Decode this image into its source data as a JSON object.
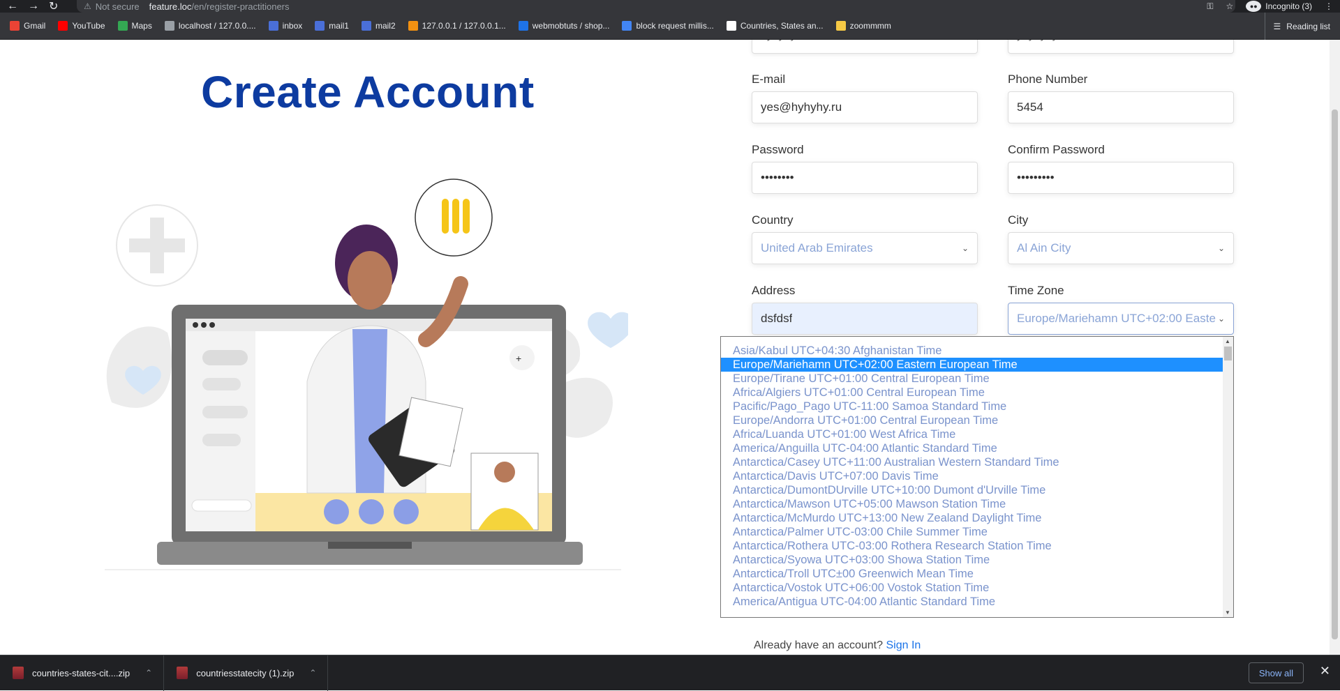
{
  "browser": {
    "not_secure": "Not secure",
    "url_host": "feature.loc",
    "url_path": "/en/register-practitioners",
    "incognito": "Incognito (3)",
    "bookmarks": [
      {
        "label": "Gmail",
        "icon": "gmail-icon",
        "color": "#ea4335"
      },
      {
        "label": "YouTube",
        "icon": "youtube-icon",
        "color": "#ff0000"
      },
      {
        "label": "Maps",
        "icon": "maps-icon",
        "color": "#34a853"
      },
      {
        "label": "localhost / 127.0.0....",
        "icon": "globe-icon",
        "color": "#9aa0a6"
      },
      {
        "label": "inbox",
        "icon": "mail-icon",
        "color": "#4a6fd8"
      },
      {
        "label": "mail1",
        "icon": "mail-icon",
        "color": "#4a6fd8"
      },
      {
        "label": "mail2",
        "icon": "mail-icon",
        "color": "#4a6fd8"
      },
      {
        "label": "127.0.0.1 / 127.0.0.1...",
        "icon": "pma-icon",
        "color": "#f29111"
      },
      {
        "label": "webmobtuts / shop...",
        "icon": "laravel-icon",
        "color": "#1e73e8"
      },
      {
        "label": "block request millis...",
        "icon": "google-icon",
        "color": "#4285f4"
      },
      {
        "label": "Countries, States an...",
        "icon": "github-icon",
        "color": "#ffffff"
      },
      {
        "label": "zoommmm",
        "icon": "folder-icon",
        "color": "#f6c945"
      }
    ],
    "reading_list": "Reading list"
  },
  "page": {
    "title": "Create Account",
    "partial_top_left": "hyhyhyh",
    "partial_top_right": "yhyhyhyh",
    "fields": {
      "email_label": "E-mail",
      "email_value": "yes@hyhyhy.ru",
      "phone_label": "Phone Number",
      "phone_value": "5454",
      "password_label": "Password",
      "password_value": "••••••••",
      "confirm_label": "Confirm Password",
      "confirm_value": "•••••••••",
      "country_label": "Country",
      "country_value": "United Arab Emirates",
      "city_label": "City",
      "city_value": "Al Ain City",
      "address_label": "Address",
      "address_value": "dsfdsf",
      "timezone_label": "Time Zone",
      "timezone_value": "Europe/Mariehamn UTC+02:00 Eastern European Time"
    },
    "timezone_options": [
      "Asia/Kabul UTC+04:30 Afghanistan Time",
      "Europe/Mariehamn UTC+02:00 Eastern European Time",
      "Europe/Tirane UTC+01:00 Central European Time",
      "Africa/Algiers UTC+01:00 Central European Time",
      "Pacific/Pago_Pago UTC-11:00 Samoa Standard Time",
      "Europe/Andorra UTC+01:00 Central European Time",
      "Africa/Luanda UTC+01:00 West Africa Time",
      "America/Anguilla UTC-04:00 Atlantic Standard Time",
      "Antarctica/Casey UTC+11:00 Australian Western Standard Time",
      "Antarctica/Davis UTC+07:00 Davis Time",
      "Antarctica/DumontDUrville UTC+10:00 Dumont d'Urville Time",
      "Antarctica/Mawson UTC+05:00 Mawson Station Time",
      "Antarctica/McMurdo UTC+13:00 New Zealand Daylight Time",
      "Antarctica/Palmer UTC-03:00 Chile Summer Time",
      "Antarctica/Rothera UTC-03:00 Rothera Research Station Time",
      "Antarctica/Syowa UTC+03:00 Showa Station Time",
      "Antarctica/Troll UTC±00 Greenwich Mean Time",
      "Antarctica/Vostok UTC+06:00 Vostok Station Time",
      "America/Antigua UTC-04:00 Atlantic Standard Time"
    ],
    "selected_option_index": 1,
    "already_text": "Already have an account?",
    "sign_in": "Sign In"
  },
  "downloads": {
    "items": [
      "countries-states-cit....zip",
      "countriesstatecity (1).zip"
    ],
    "show_all": "Show all"
  }
}
